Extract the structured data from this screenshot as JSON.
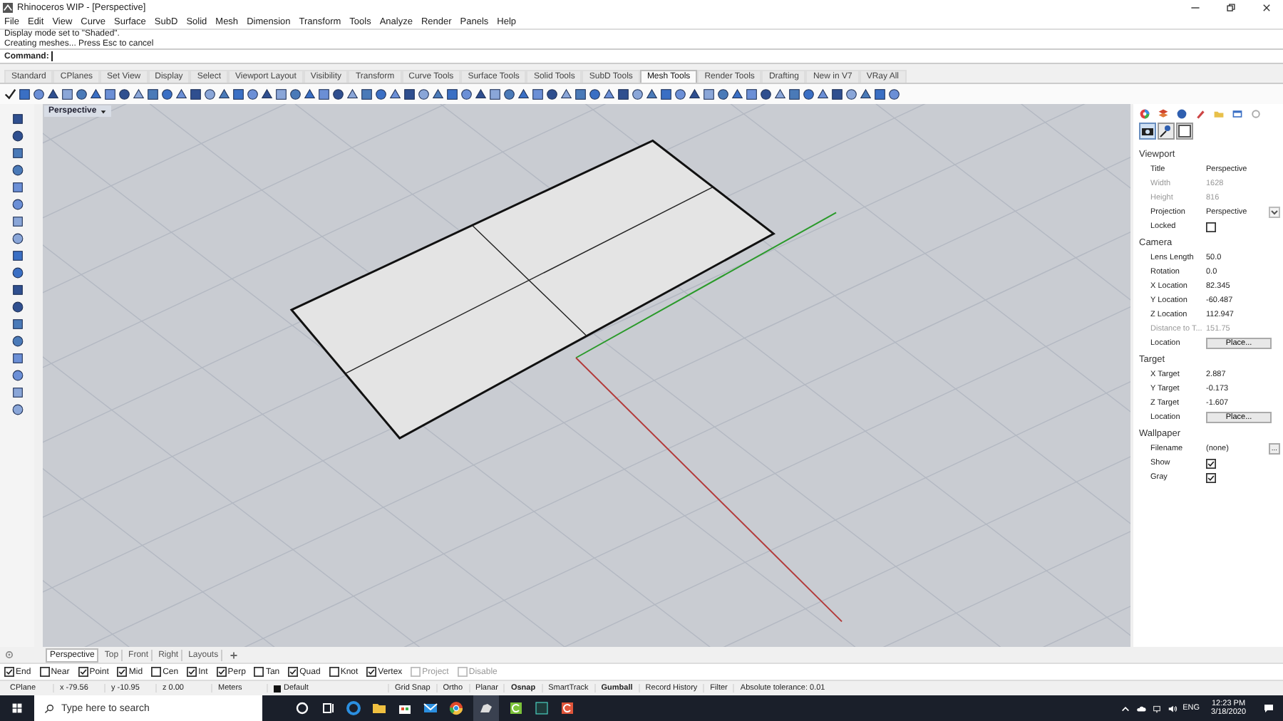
{
  "window": {
    "title": "Rhinoceros WIP - [Perspective]"
  },
  "menu": [
    "File",
    "Edit",
    "View",
    "Curve",
    "Surface",
    "SubD",
    "Solid",
    "Mesh",
    "Dimension",
    "Transform",
    "Tools",
    "Analyze",
    "Render",
    "Panels",
    "Help"
  ],
  "command_history": [
    "Display mode set to \"Shaded\".",
    "Creating meshes... Press Esc to cancel"
  ],
  "command_prompt": "Command:",
  "toolbar_tabs": [
    {
      "label": "Standard",
      "selected": false
    },
    {
      "label": "CPlanes",
      "selected": false
    },
    {
      "label": "Set View",
      "selected": false
    },
    {
      "label": "Display",
      "selected": false
    },
    {
      "label": "Select",
      "selected": false
    },
    {
      "label": "Viewport Layout",
      "selected": false
    },
    {
      "label": "Visibility",
      "selected": false
    },
    {
      "label": "Transform",
      "selected": false
    },
    {
      "label": "Curve Tools",
      "selected": false
    },
    {
      "label": "Surface Tools",
      "selected": false
    },
    {
      "label": "Solid Tools",
      "selected": false
    },
    {
      "label": "SubD Tools",
      "selected": false
    },
    {
      "label": "Mesh Tools",
      "selected": true
    },
    {
      "label": "Render Tools",
      "selected": false
    },
    {
      "label": "Drafting",
      "selected": false
    },
    {
      "label": "New in V7",
      "selected": false
    },
    {
      "label": "VRay All",
      "selected": false
    }
  ],
  "viewport": {
    "label": "Perspective"
  },
  "panel": {
    "sections": [
      {
        "title": "Viewport",
        "rows": [
          {
            "label": "Title",
            "kind": "text",
            "value": "Perspective"
          },
          {
            "label": "Width",
            "kind": "readonly",
            "value": "1628"
          },
          {
            "label": "Height",
            "kind": "readonly",
            "value": "816"
          },
          {
            "label": "Projection",
            "kind": "dropdown",
            "value": "Perspective"
          },
          {
            "label": "Locked",
            "kind": "checkbox",
            "checked": false
          }
        ]
      },
      {
        "title": "Camera",
        "rows": [
          {
            "label": "Lens Length",
            "kind": "text",
            "value": "50.0"
          },
          {
            "label": "Rotation",
            "kind": "text",
            "value": "0.0"
          },
          {
            "label": "X Location",
            "kind": "text",
            "value": "82.345"
          },
          {
            "label": "Y Location",
            "kind": "text",
            "value": "-60.487"
          },
          {
            "label": "Z Location",
            "kind": "text",
            "value": "112.947"
          },
          {
            "label": "Distance to T...",
            "kind": "readonly",
            "value": "151.75"
          },
          {
            "label": "Location",
            "kind": "button",
            "value": "Place..."
          }
        ]
      },
      {
        "title": "Target",
        "rows": [
          {
            "label": "X Target",
            "kind": "text",
            "value": "2.887"
          },
          {
            "label": "Y Target",
            "kind": "text",
            "value": "-0.173"
          },
          {
            "label": "Z Target",
            "kind": "text",
            "value": "-1.607"
          },
          {
            "label": "Location",
            "kind": "button",
            "value": "Place..."
          }
        ]
      },
      {
        "title": "Wallpaper",
        "rows": [
          {
            "label": "Filename",
            "kind": "file",
            "value": "(none)",
            "button": "..."
          },
          {
            "label": "Show",
            "kind": "checkbox",
            "checked": true
          },
          {
            "label": "Gray",
            "kind": "checkbox",
            "checked": true
          }
        ]
      }
    ]
  },
  "viewport_tabs": [
    {
      "label": "Perspective",
      "selected": true
    },
    {
      "label": "Top",
      "selected": false
    },
    {
      "label": "Front",
      "selected": false
    },
    {
      "label": "Right",
      "selected": false
    },
    {
      "label": "Layouts",
      "selected": false
    }
  ],
  "osnaps": [
    {
      "label": "End",
      "checked": true,
      "disabled": false
    },
    {
      "label": "Near",
      "checked": false,
      "disabled": false
    },
    {
      "label": "Point",
      "checked": true,
      "disabled": false
    },
    {
      "label": "Mid",
      "checked": true,
      "disabled": false
    },
    {
      "label": "Cen",
      "checked": false,
      "disabled": false
    },
    {
      "label": "Int",
      "checked": true,
      "disabled": false
    },
    {
      "label": "Perp",
      "checked": true,
      "disabled": false
    },
    {
      "label": "Tan",
      "checked": false,
      "disabled": false
    },
    {
      "label": "Quad",
      "checked": true,
      "disabled": false
    },
    {
      "label": "Knot",
      "checked": false,
      "disabled": false
    },
    {
      "label": "Vertex",
      "checked": true,
      "disabled": false
    },
    {
      "label": "Project",
      "checked": false,
      "disabled": true
    },
    {
      "label": "Disable",
      "checked": false,
      "disabled": true
    }
  ],
  "status_bar": [
    {
      "kind": "field",
      "text": "CPlane"
    },
    {
      "kind": "field",
      "text": "x -79.56"
    },
    {
      "kind": "field",
      "text": "y -10.95"
    },
    {
      "kind": "field",
      "text": "z 0.00"
    },
    {
      "kind": "field",
      "text": "Meters"
    },
    {
      "kind": "layer",
      "text": "Default"
    },
    {
      "kind": "toggle",
      "text": "Grid Snap",
      "on": false
    },
    {
      "kind": "toggle",
      "text": "Ortho",
      "on": false
    },
    {
      "kind": "toggle",
      "text": "Planar",
      "on": false
    },
    {
      "kind": "toggle",
      "text": "Osnap",
      "on": true
    },
    {
      "kind": "toggle",
      "text": "SmartTrack",
      "on": false
    },
    {
      "kind": "toggle",
      "text": "Gumball",
      "on": true
    },
    {
      "kind": "toggle",
      "text": "Record History",
      "on": false
    },
    {
      "kind": "toggle",
      "text": "Filter",
      "on": false
    },
    {
      "kind": "field",
      "text": "Absolute tolerance: 0.01"
    }
  ],
  "taskbar": {
    "search_placeholder": "Type here to search",
    "language": "ENG",
    "time": "12:23 PM",
    "date": "3/18/2020"
  }
}
